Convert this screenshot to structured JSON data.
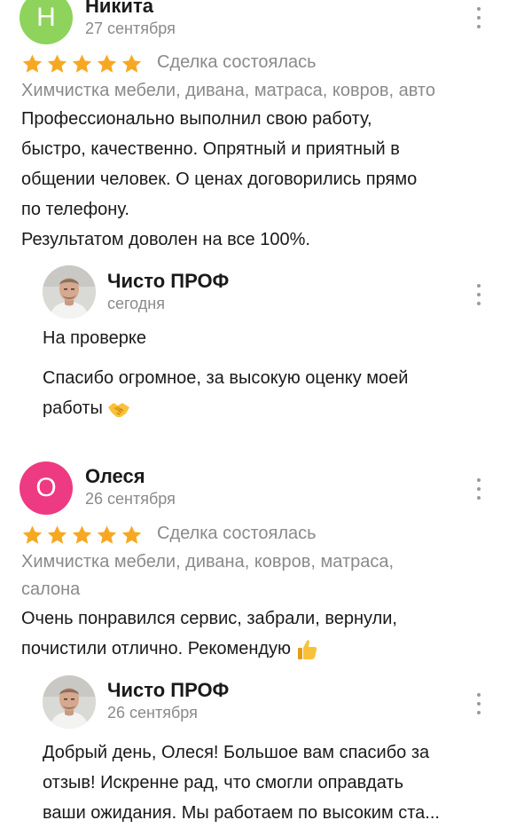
{
  "colors": {
    "avatar_n": "#8dd35c",
    "avatar_o": "#ee3a82",
    "star": "#f7a823",
    "muted": "#8a8a8a"
  },
  "reviews": [
    {
      "avatar_letter": "Н",
      "author": "Никита",
      "date": "27 сентября",
      "rating": 5,
      "deal_status": "Сделка состоялась",
      "category": "Химчистка мебели, дивана, матраса, ковров, авто",
      "text_lines": [
        "Профессионально выполнил свою работу,",
        "быстро, качественно. Опрятный и приятный в",
        "общении человек. О ценах договорились прямо",
        "по телефону.",
        "Результатом доволен на все 100%."
      ],
      "reply": {
        "author": "Чисто ПРОФ",
        "date": "сегодня",
        "status": "На проверке",
        "text_lines": [
          "Спасибо огромное, за высокую оценку моей",
          "работы"
        ],
        "emoji": "handshake-emoji"
      }
    },
    {
      "avatar_letter": "О",
      "author": "Олеся",
      "date": "26 сентября",
      "rating": 5,
      "deal_status": "Сделка состоялась",
      "category_lines": [
        "Химчистка мебели, дивана, ковров, матраса,",
        "салона"
      ],
      "text_lines": [
        "Очень понравился сервис, забрали, вернули,",
        "почистили отлично. Рекомендую"
      ],
      "emoji": "thumbs-up-emoji",
      "reply": {
        "author": "Чисто ПРОФ",
        "date": "26 сентября",
        "text_lines": [
          "Добрый день, Олеся! Большое вам спасибо за",
          "отзыв! Искренне рад, что смогли оправдать",
          "ваши ожидания. Мы работаем по высоким ста..."
        ]
      }
    }
  ]
}
